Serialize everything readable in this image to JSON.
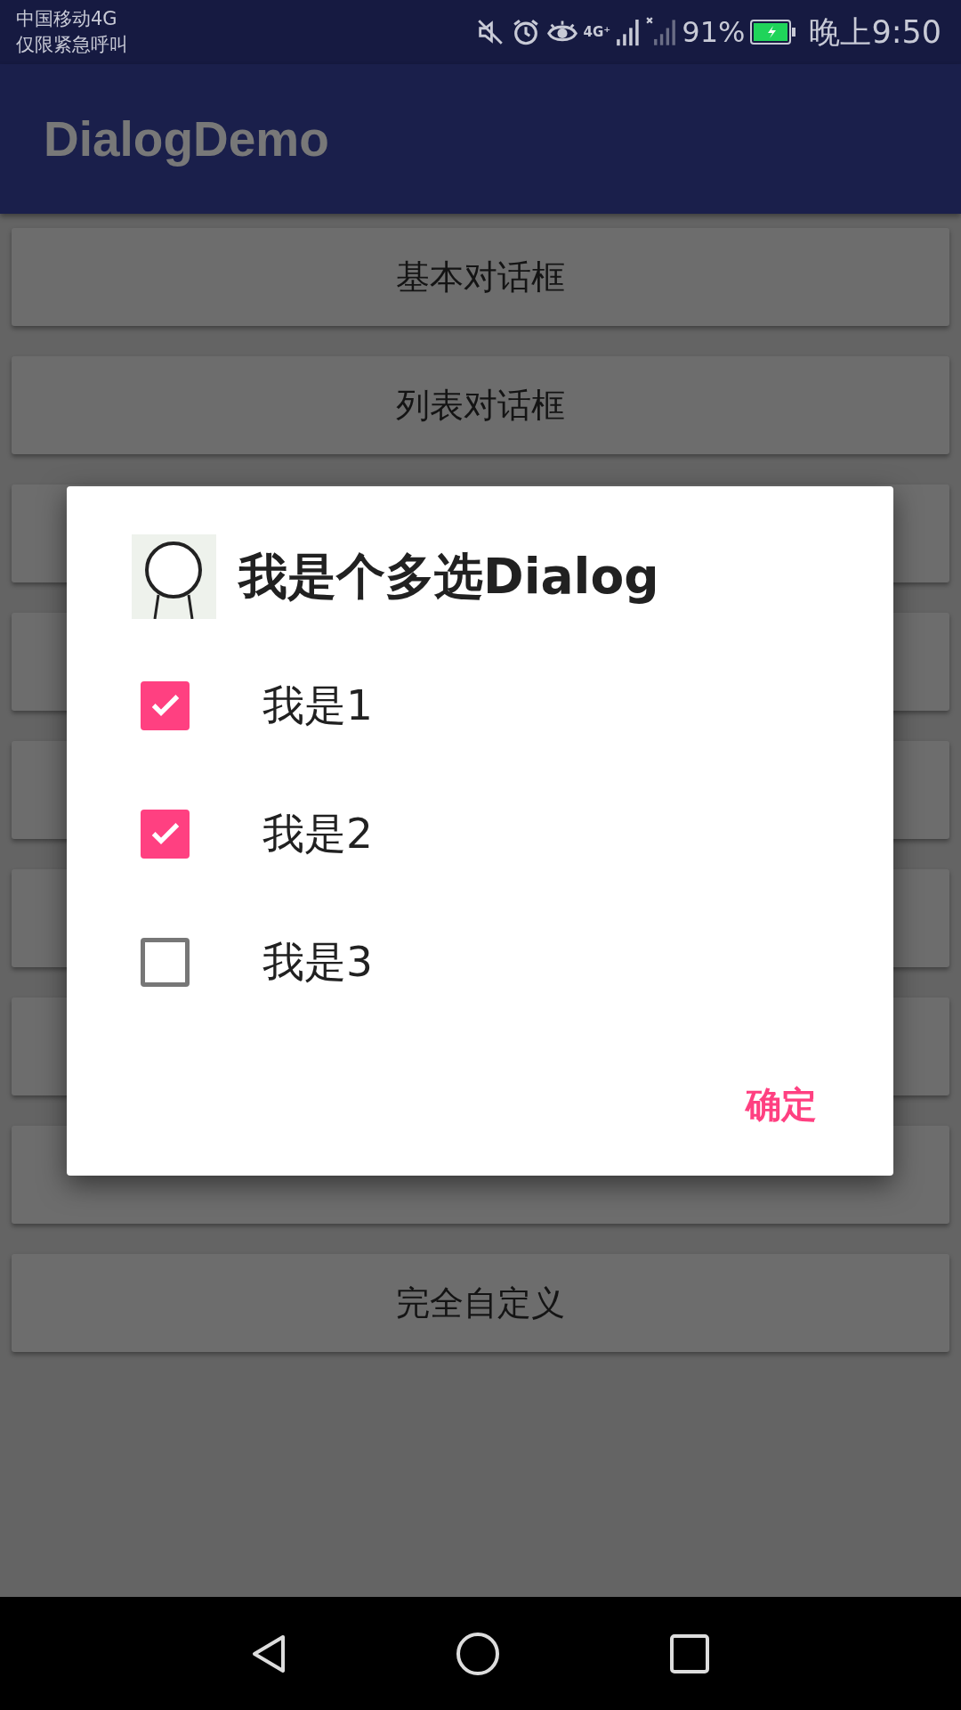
{
  "status_bar": {
    "carrier": "中国移动4G",
    "emergency": "仅限紧急呼叫",
    "network": "4G⁺",
    "battery_percent": "91%",
    "time": "晚上9:50"
  },
  "app_bar": {
    "title": "DialogDemo"
  },
  "buttons": [
    {
      "kind": "labeled",
      "label": "基本对话框"
    },
    {
      "kind": "labeled",
      "label": "列表对话框"
    },
    {
      "kind": "covered"
    },
    {
      "kind": "covered"
    },
    {
      "kind": "covered"
    },
    {
      "kind": "covered"
    },
    {
      "kind": "covered"
    },
    {
      "kind": "covered"
    },
    {
      "kind": "labeled",
      "label": "完全自定义"
    }
  ],
  "dialog": {
    "title": "我是个多选Dialog",
    "options": [
      {
        "label": "我是1",
        "checked": true
      },
      {
        "label": "我是2",
        "checked": true
      },
      {
        "label": "我是3",
        "checked": false
      }
    ],
    "confirm": "确定"
  }
}
